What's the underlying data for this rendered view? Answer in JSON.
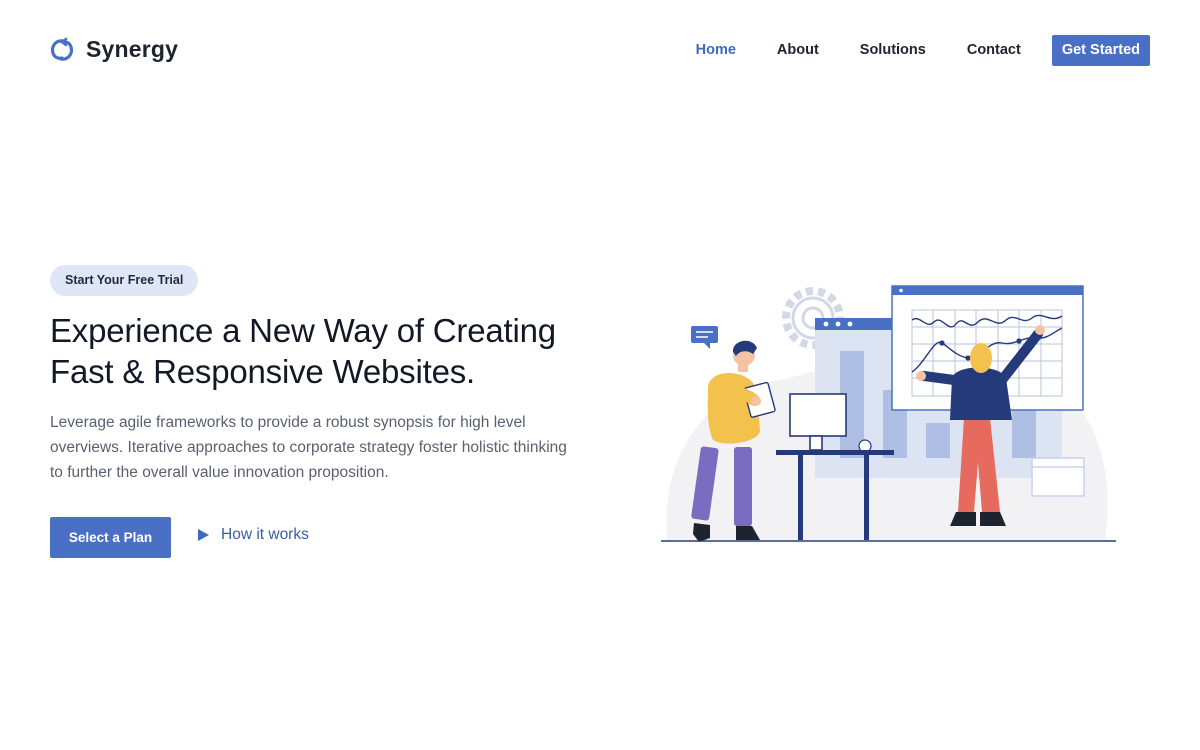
{
  "brand": {
    "name": "Synergy",
    "logo_icon": "swirl-logo-icon"
  },
  "nav": {
    "items": [
      {
        "label": "Home",
        "active": true
      },
      {
        "label": "About",
        "active": false
      },
      {
        "label": "Solutions",
        "active": false
      },
      {
        "label": "Contact",
        "active": false
      }
    ],
    "cta_label": "Get Started"
  },
  "hero": {
    "badge": "Start Your Free Trial",
    "headline_lines": [
      "Experience a New Way of Creating",
      "Fast & Responsive Websites."
    ],
    "description_lines": [
      "Leverage agile frameworks to provide a robust synopsis for high level",
      "overviews. Iterative approaches to corporate strategy foster holistic thinking",
      "to further the overall value innovation proposition."
    ],
    "primary_button": "Select a Plan",
    "secondary_link": "How it works",
    "secondary_icon": "play-icon"
  },
  "illustration": {
    "icon": "team-analytics-illustration"
  },
  "colors": {
    "accent": "#4a70c6",
    "accent_dark": "#253a7a",
    "badge_bg": "#dfe6f5",
    "text_dark": "#1e2330",
    "text_muted": "#5a6070"
  }
}
